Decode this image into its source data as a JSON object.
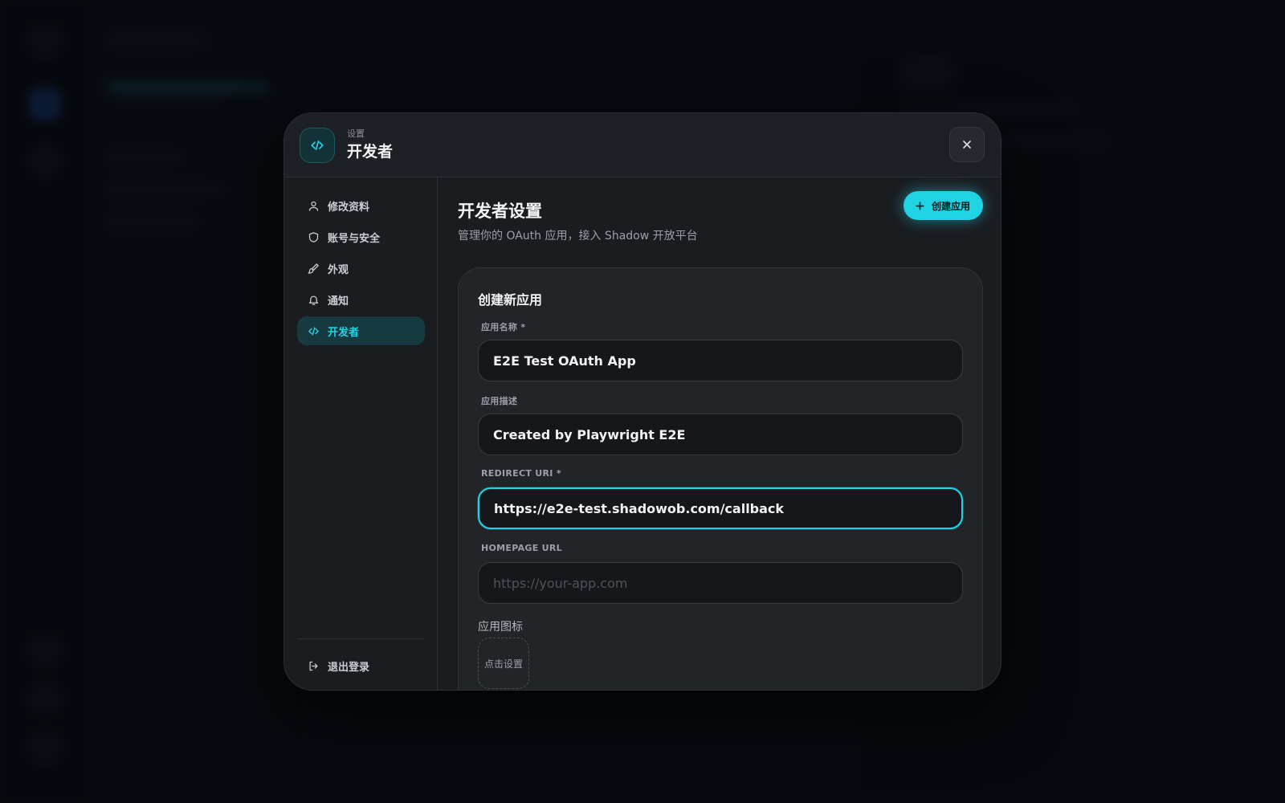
{
  "header": {
    "subtitle": "设置",
    "title": "开发者"
  },
  "sidebar": {
    "items": [
      {
        "label": "修改资料",
        "icon": "user-icon"
      },
      {
        "label": "账号与安全",
        "icon": "shield-icon"
      },
      {
        "label": "外观",
        "icon": "brush-icon"
      },
      {
        "label": "通知",
        "icon": "bell-icon"
      },
      {
        "label": "开发者",
        "icon": "code-icon",
        "active": true
      }
    ],
    "logout_label": "退出登录"
  },
  "main": {
    "title": "开发者设置",
    "subtitle": "管理你的 OAuth 应用，接入 Shadow 开放平台",
    "create_button": "创建应用",
    "form": {
      "title": "创建新应用",
      "name_label": "应用名称 *",
      "name_value": "E2E Test OAuth App",
      "description_label": "应用描述",
      "description_value": "Created by Playwright E2E",
      "redirect_label": "REDIRECT URI *",
      "redirect_value": "https://e2e-test.shadowob.com/callback",
      "homepage_label": "HOMEPAGE URL",
      "homepage_placeholder": "https://your-app.com",
      "icon_label": "应用图标",
      "icon_picker": "点击设置"
    }
  },
  "colors": {
    "accent": "#22d3e6",
    "modal_bg": "#1a1c20",
    "card_bg": "#222428"
  }
}
